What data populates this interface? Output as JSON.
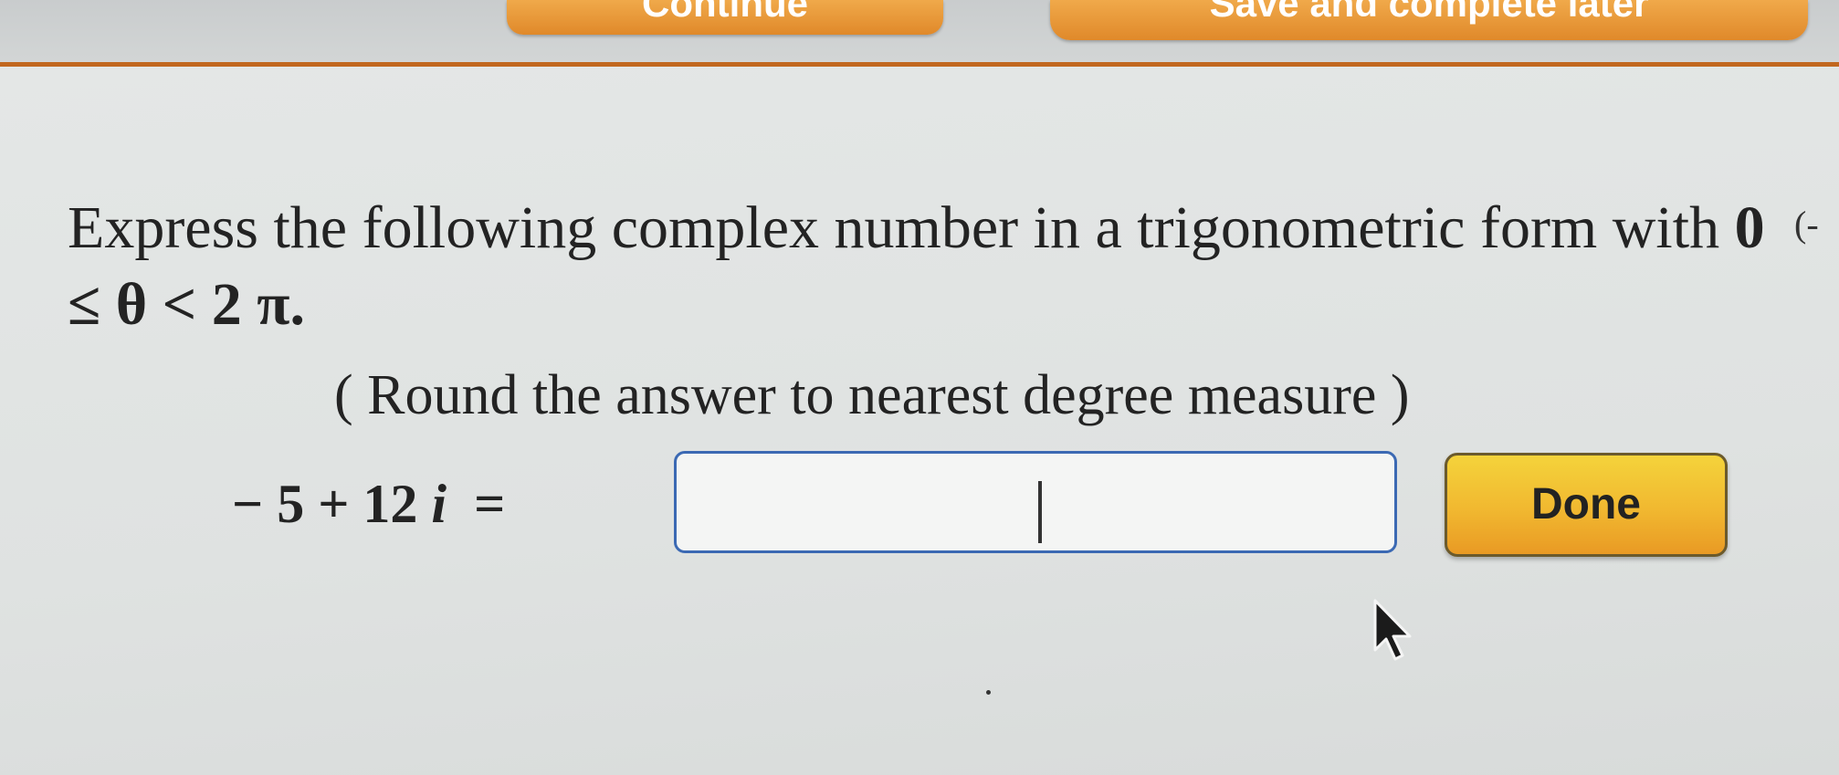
{
  "header": {
    "button_1_label": "Continue",
    "button_2_label": "Save and complete later"
  },
  "question": {
    "text": "Express the following complex number in a trigonometric form with",
    "constraint": "0 ≤ θ < 2 π.",
    "side_mark": "(-",
    "instruction": "( Round the answer to nearest degree measure )",
    "equation_left": "− 5 + 12",
    "equation_i": "i",
    "equation_equals": "="
  },
  "answer": {
    "value": "",
    "placeholder": ""
  },
  "done_button": {
    "label": "Done"
  },
  "colors": {
    "accent_orange": "#e0892a",
    "done_yellow": "#f1b830",
    "input_border_blue": "#3b69b3"
  },
  "icons": [
    "mouse-pointer-icon"
  ]
}
